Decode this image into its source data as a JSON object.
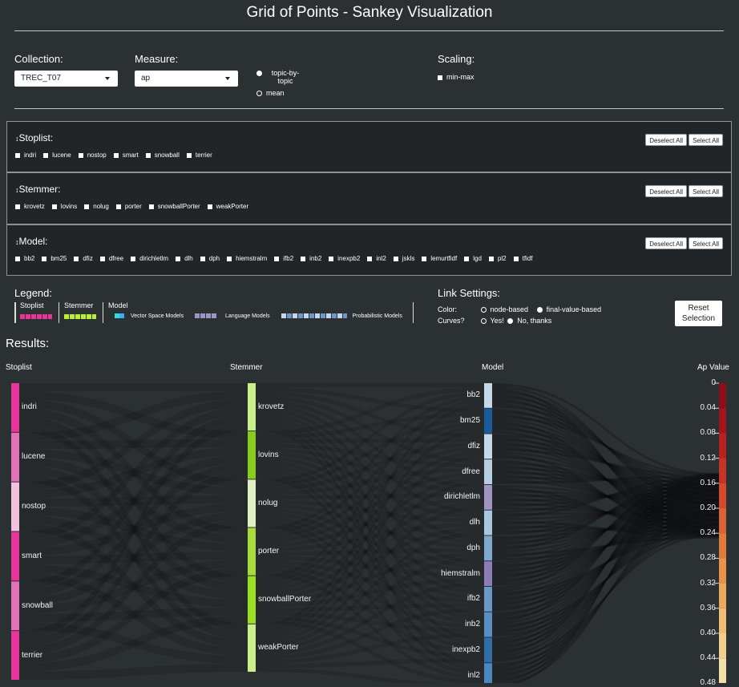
{
  "title": "Grid of Points - Sankey Visualization",
  "controls": {
    "collection_label": "Collection:",
    "collection_value": "TREC_T07",
    "measure_label": "Measure:",
    "measure_value": "ap",
    "mode_options": [
      "topic-by-topic",
      "mean"
    ],
    "mode_selected": "topic-by-topic",
    "scaling_label": "Scaling:",
    "scaling_option": "min-max"
  },
  "filters": {
    "stoplist": {
      "title": "Stoplist:",
      "items": [
        "indri",
        "lucene",
        "nostop",
        "smart",
        "snowball",
        "terrier"
      ]
    },
    "stemmer": {
      "title": "Stemmer:",
      "items": [
        "krovetz",
        "lovins",
        "nolug",
        "porter",
        "snowballPorter",
        "weakPorter"
      ]
    },
    "model": {
      "title": "Model:",
      "items": [
        "bb2",
        "bm25",
        "dfiz",
        "dfree",
        "dirichletlm",
        "dlh",
        "dph",
        "hiemstralm",
        "ifb2",
        "inb2",
        "inexpb2",
        "inl2",
        "jskls",
        "lemurtfidf",
        "lgd",
        "pl2",
        "tfidf"
      ]
    },
    "deselect_label": "Deselect All",
    "select_label": "Select All"
  },
  "legend": {
    "title": "Legend:",
    "stoplist": "Stoplist",
    "stemmer": "Stemmer",
    "model": "Model",
    "vsm": "Vector Space Models",
    "lm": "Language Models",
    "pm": "Probabilistic Models"
  },
  "link_settings": {
    "title": "Link Settings:",
    "color_label": "Color:",
    "color_options": [
      "node-based",
      "final-value-based"
    ],
    "curves_label": "Curves?",
    "curves_options": [
      "Yes!",
      "No, thanks"
    ],
    "reset_label_1": "Reset",
    "reset_label_2": "Selection"
  },
  "results": {
    "title": "Results:",
    "col_stoplist": "Stoplist",
    "col_stemmer": "Stemmer",
    "col_model": "Model",
    "col_value": "Ap Value"
  },
  "colors": {
    "stoplist": [
      "#e8359b",
      "#e373b8",
      "#f0c2dd",
      "#e8359b",
      "#e373b8",
      "#e8359b"
    ],
    "stemmer": [
      "#c9f08a",
      "#8acc1a",
      "#e0f0c0",
      "#a6dd3a",
      "#98e020",
      "#c9f08a"
    ],
    "model": [
      "#c6d9ea",
      "#1d5a99",
      "#c6d9ea",
      "#b6cde0",
      "#9e95c4",
      "#a8c6de",
      "#7ea8cc",
      "#8a7eb5",
      "#6b98c4",
      "#5a8ec2",
      "#2f6fa8",
      "#4a86bf"
    ],
    "ap_scale": [
      "#8b0f1a",
      "#a3141c",
      "#b8211f",
      "#c73326",
      "#d24a2b",
      "#db6232",
      "#e27a3b",
      "#e8924a",
      "#eca95d",
      "#efbe74",
      "#f1d08c",
      "#f3e0a7"
    ]
  },
  "chart_data": {
    "type": "sankey",
    "columns": [
      "Stoplist",
      "Stemmer",
      "Model",
      "Ap Value"
    ],
    "stoplist_nodes": [
      "indri",
      "lucene",
      "nostop",
      "smart",
      "snowball",
      "terrier"
    ],
    "stemmer_nodes": [
      "krovetz",
      "lovins",
      "nolug",
      "porter",
      "snowballPorter",
      "weakPorter"
    ],
    "model_nodes": [
      "bb2",
      "bm25",
      "dfiz",
      "dfree",
      "dirichletlm",
      "dlh",
      "dph",
      "hiemstralm",
      "ifb2",
      "inb2",
      "inexpb2",
      "inl2"
    ],
    "value_ticks": [
      "0",
      "0.04",
      "0.08",
      "0.12",
      "0.16",
      "0.20",
      "0.24",
      "0.28",
      "0.32",
      "0.36",
      "0.40",
      "0.44",
      "0.48"
    ]
  }
}
